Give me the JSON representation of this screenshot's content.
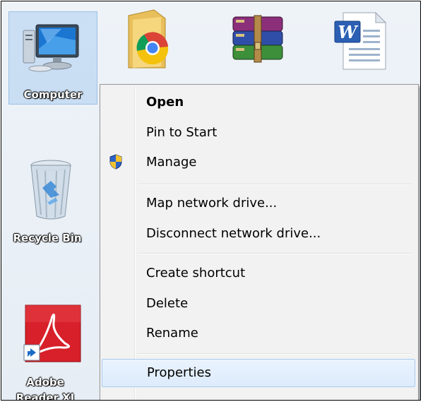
{
  "desktop": {
    "icons": [
      {
        "label": "Computer"
      },
      {
        "label": "Recycle Bin"
      },
      {
        "label": "Adobe Reader XI"
      }
    ]
  },
  "context_menu": {
    "items": [
      {
        "label": "Open"
      },
      {
        "label": "Pin to Start"
      },
      {
        "label": "Manage",
        "icon": "uac-shield-icon"
      },
      {
        "label": "Map network drive..."
      },
      {
        "label": "Disconnect network drive..."
      },
      {
        "label": "Create shortcut"
      },
      {
        "label": "Delete"
      },
      {
        "label": "Rename"
      },
      {
        "label": "Properties"
      }
    ]
  },
  "colors": {
    "selection": "#adcef0",
    "menu_background": "#f2f2f2",
    "hover_border": "#a8cbf1"
  }
}
